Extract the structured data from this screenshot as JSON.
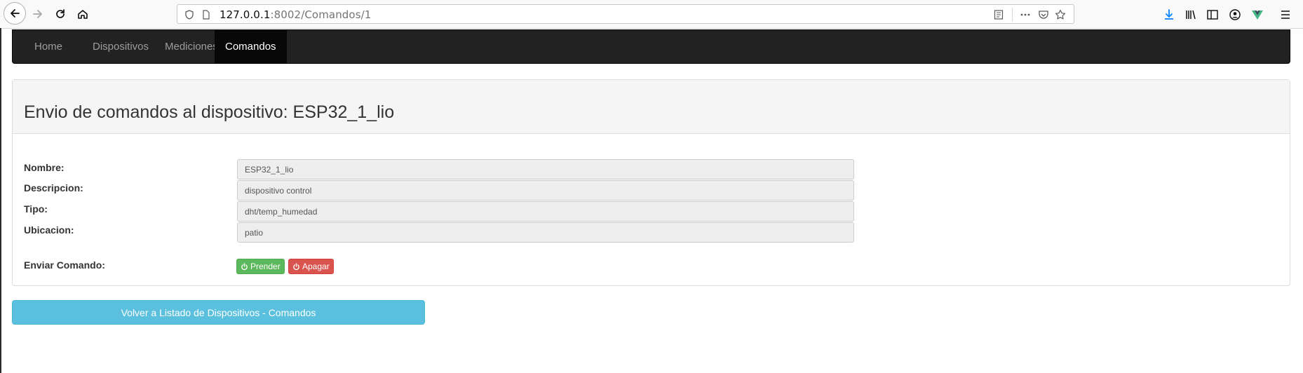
{
  "browser": {
    "url_host": "127.0.0.1",
    "url_rest": ":8002/Comandos/1",
    "icons": [
      "back-icon",
      "forward-icon",
      "reload-icon",
      "home-icon",
      "shield-icon",
      "page-icon",
      "reader-view-icon",
      "more-icon",
      "pocket-icon",
      "bookmark-star-icon",
      "download-icon",
      "library-icon",
      "sidebar-icon",
      "account-icon",
      "vue-devtools-icon",
      "menu-icon"
    ]
  },
  "navbar": {
    "items": [
      {
        "label": "Home",
        "active": false
      },
      {
        "label": "Dispositivos",
        "active": false
      },
      {
        "label": "Mediciones",
        "active": false
      },
      {
        "label": "Comandos",
        "active": true
      }
    ]
  },
  "panel": {
    "title": "Envio de comandos al dispositivo: ESP32_1_lio",
    "fields": [
      {
        "label": "Nombre:",
        "value": "ESP32_1_lio"
      },
      {
        "label": "Descripcion:",
        "value": "dispositivo control"
      },
      {
        "label": "Tipo:",
        "value": "dht/temp_humedad"
      },
      {
        "label": "Ubicacion:",
        "value": "patio"
      }
    ],
    "command_label": "Enviar Comando:",
    "buttons": {
      "on_label": "Prender",
      "off_label": "Apagar"
    }
  },
  "back_button": "Volver a Listado de Dispositivos - Comandos",
  "colors": {
    "navbar_bg": "#222222",
    "success": "#5cb85c",
    "danger": "#d9534f",
    "info": "#5bc0de"
  }
}
